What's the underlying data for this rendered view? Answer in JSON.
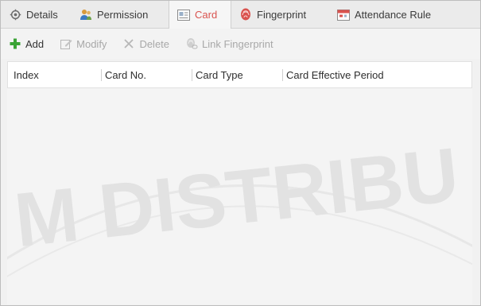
{
  "tabs": [
    {
      "label": "Details",
      "icon": "gear-icon"
    },
    {
      "label": "Permission",
      "icon": "users-icon"
    },
    {
      "label": "Card",
      "icon": "card-icon"
    },
    {
      "label": "Fingerprint",
      "icon": "fingerprint-icon"
    },
    {
      "label": "Attendance Rule",
      "icon": "calendar-icon"
    }
  ],
  "active_tab": "Card",
  "toolbar": {
    "add_label": "Add",
    "modify_label": "Modify",
    "delete_label": "Delete",
    "link_fingerprint_label": "Link Fingerprint"
  },
  "table": {
    "columns": [
      "Index",
      "Card No.",
      "Card Type",
      "Card Effective Period"
    ],
    "rows": []
  },
  "watermark_text": "M DISTRIBU",
  "colors": {
    "active_tab_text": "#d9534f",
    "add_icon": "#3aa335",
    "disabled_text": "#a8a8a8"
  }
}
